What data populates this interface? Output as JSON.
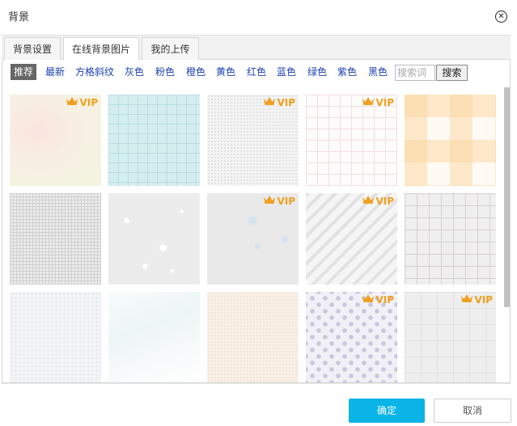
{
  "dialog": {
    "title": "背景",
    "close_symbol": "✕"
  },
  "tabs": [
    {
      "label": "背景设置",
      "active": false
    },
    {
      "label": "在线背景图片",
      "active": true
    },
    {
      "label": "我的上传",
      "active": false
    }
  ],
  "filters": [
    {
      "label": "推荐",
      "active": true
    },
    {
      "label": "最新"
    },
    {
      "label": "方格斜纹"
    },
    {
      "label": "灰色"
    },
    {
      "label": "粉色"
    },
    {
      "label": "橙色"
    },
    {
      "label": "黄色"
    },
    {
      "label": "红色"
    },
    {
      "label": "蓝色"
    },
    {
      "label": "绿色"
    },
    {
      "label": "紫色"
    },
    {
      "label": "黑色"
    }
  ],
  "search": {
    "placeholder": "搜索词",
    "button_label": "搜索"
  },
  "vip_label": "VIP",
  "tiles": [
    {
      "pattern": "watercolor-cream",
      "vip": true
    },
    {
      "pattern": "cyan-grid",
      "vip": false
    },
    {
      "pattern": "white-texture",
      "vip": true
    },
    {
      "pattern": "pink-fine-grid",
      "vip": true
    },
    {
      "pattern": "orange-gingham",
      "vip": false
    },
    {
      "pattern": "gray-dashed-grid",
      "vip": false
    },
    {
      "pattern": "gray-splatter",
      "vip": false
    },
    {
      "pattern": "gray-bubbles",
      "vip": true
    },
    {
      "pattern": "gray-diagonal-stripes",
      "vip": true
    },
    {
      "pattern": "gray-plaid",
      "vip": false
    },
    {
      "pattern": "white-paper",
      "vip": false
    },
    {
      "pattern": "white-speckle",
      "vip": false
    },
    {
      "pattern": "cream-paper",
      "vip": false
    },
    {
      "pattern": "lavender-dots",
      "vip": true
    },
    {
      "pattern": "light-gray-grid",
      "vip": true
    }
  ],
  "footer": {
    "ok_label": "确定",
    "cancel_label": "取消"
  },
  "colors": {
    "accent": "#0ab4e6",
    "vip": "#f0a020",
    "filter_link": "#1b3fb0",
    "filter_active_bg": "#666666"
  }
}
